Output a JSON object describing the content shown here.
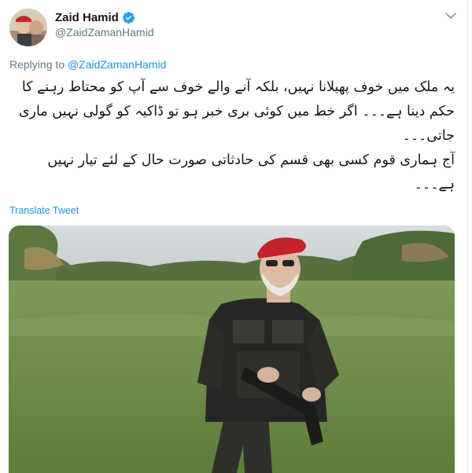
{
  "tweet": {
    "author_name": "Zaid Hamid",
    "author_handle": "@ZaidZamanHamid",
    "replying_prefix": "Replying to",
    "replying_mention": "@ZaidZamanHamid",
    "body": "یہ ملک میں خوف پھیلانا نہیں، بلکہ آنے والے خوف سے آپ کو محتاط رہنے کا حکم دینا ہے۔۔۔ اگر خط میں کوئی بری خبر ہو تو ڈاکیہ کو گولی نہیں ماری جاتی۔۔۔\nآج ہماری قوم کسی بھی قسم کی حادثاتی صورت حال کے لئے تیار نہیں ہے۔۔۔",
    "translate_label": "Translate Tweet",
    "verified": true
  },
  "icons": {
    "verified": "verified-badge-icon",
    "more": "chevron-down-icon"
  },
  "colors": {
    "link": "#1b95e0",
    "verified": "#1da1f2",
    "secondary_text": "#657786"
  }
}
